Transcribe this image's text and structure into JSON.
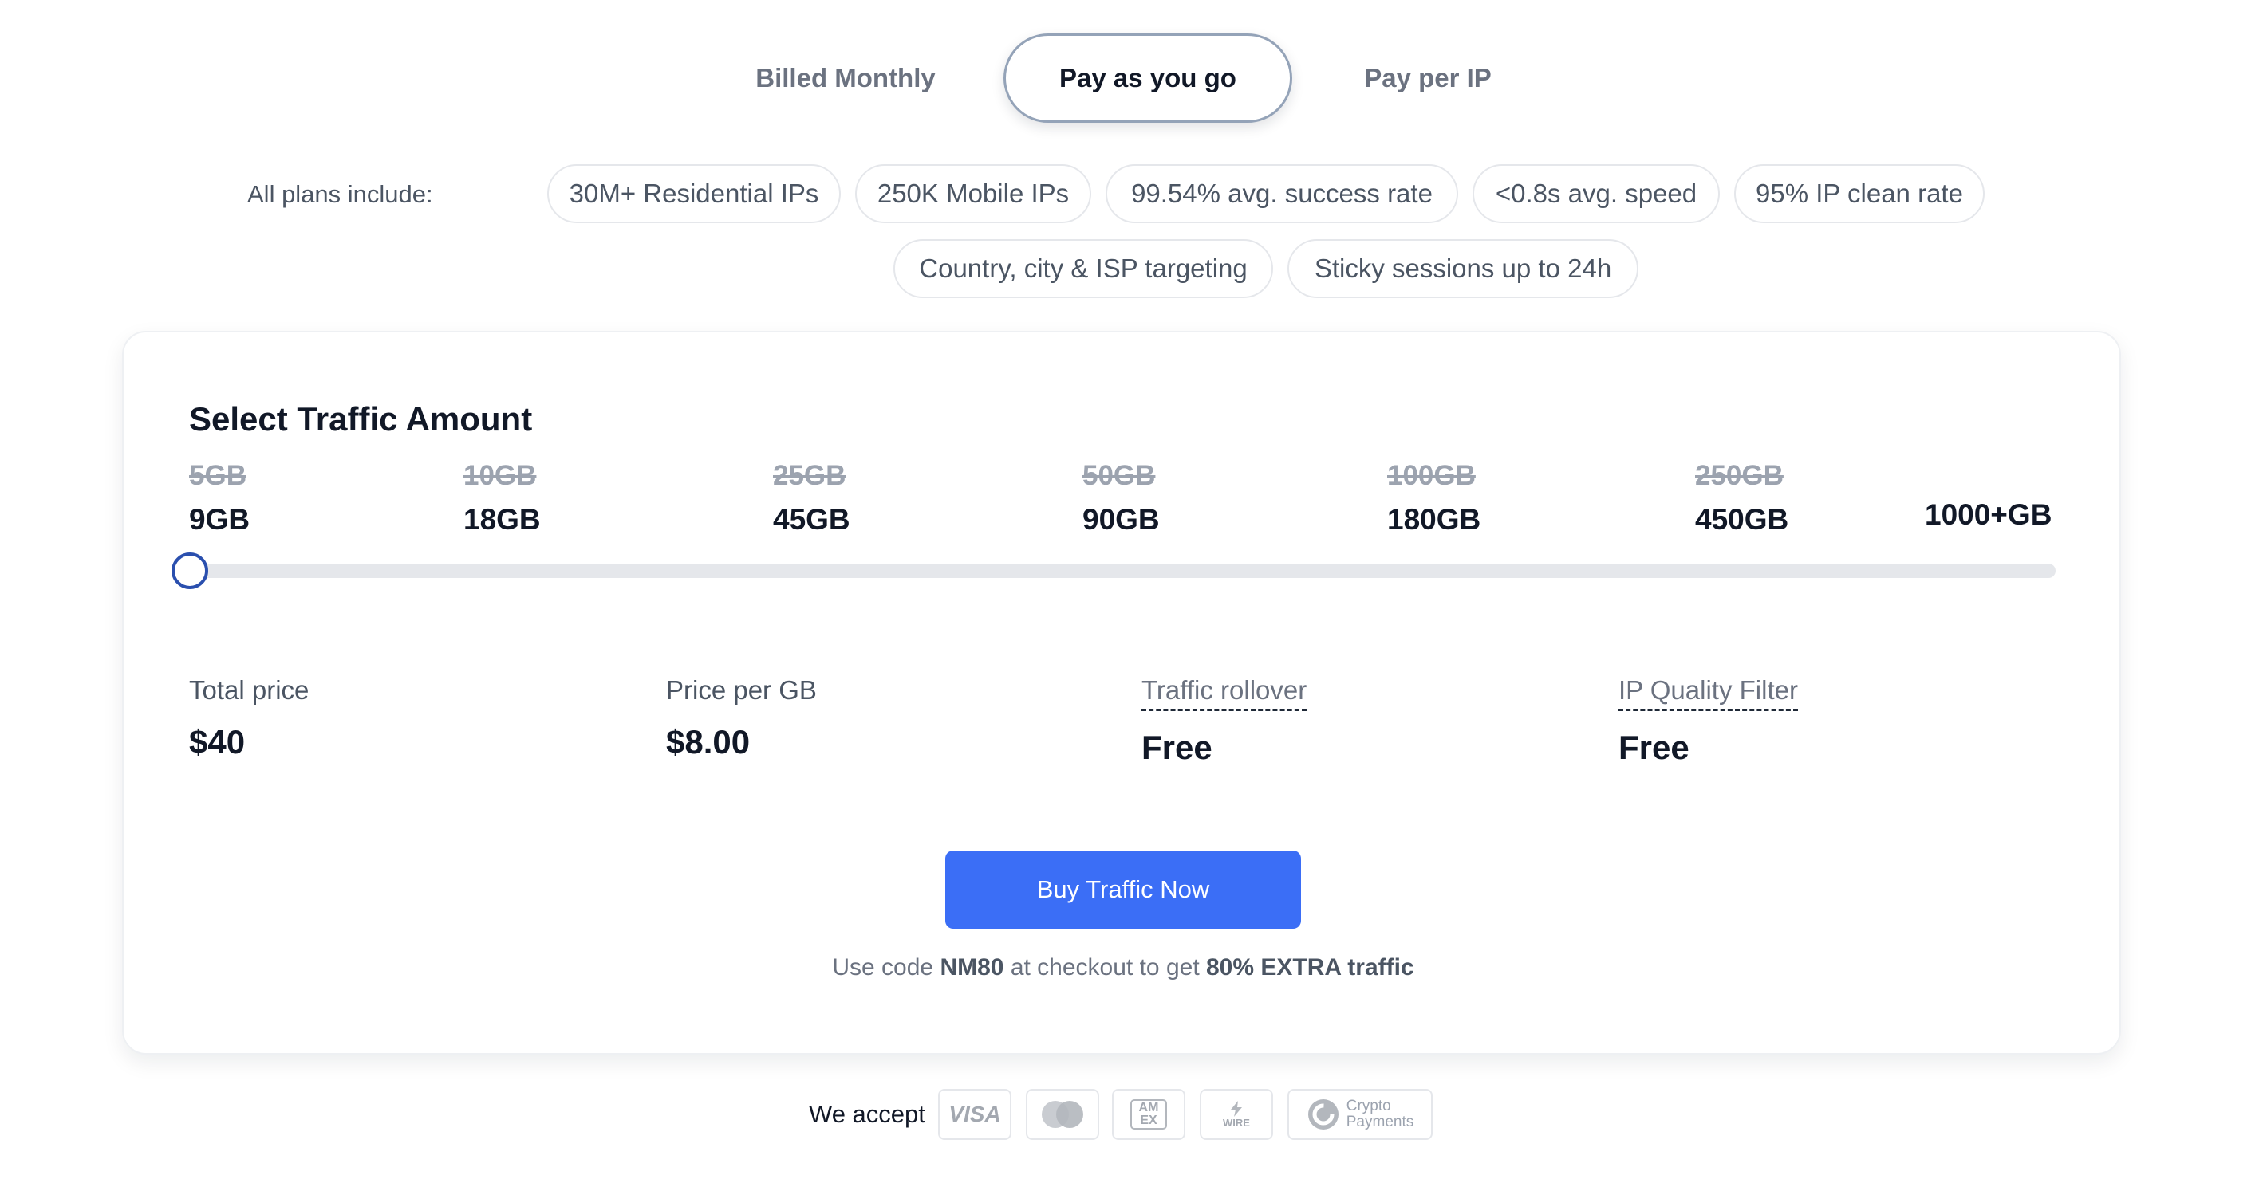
{
  "tabs": [
    {
      "label": "Billed Monthly",
      "active": false
    },
    {
      "label": "Pay as you go",
      "active": true
    },
    {
      "label": "Pay per IP",
      "active": false
    }
  ],
  "features": {
    "label": "All plans include:",
    "items": [
      "30M+ Residential IPs",
      "250K Mobile IPs",
      "99.54% avg. success rate",
      "<0.8s avg. speed",
      "95% IP clean rate",
      "Country, city & ISP targeting",
      "Sticky sessions up to 24h"
    ]
  },
  "traffic": {
    "title": "Select Traffic Amount",
    "tiers": [
      {
        "old": "5GB",
        "new": "9GB"
      },
      {
        "old": "10GB",
        "new": "18GB"
      },
      {
        "old": "25GB",
        "new": "45GB"
      },
      {
        "old": "50GB",
        "new": "90GB"
      },
      {
        "old": "100GB",
        "new": "180GB"
      },
      {
        "old": "250GB",
        "new": "450GB"
      }
    ],
    "last_tier": "1000+GB",
    "selected_index": 0
  },
  "stats": [
    {
      "label": "Total price",
      "value": "$40"
    },
    {
      "label": "Price per GB",
      "value": "$8.00"
    },
    {
      "label": "Traffic rollover",
      "value": "Free"
    },
    {
      "label": "IP Quality Filter",
      "value": "Free"
    }
  ],
  "cta": {
    "button": "Buy Traffic Now",
    "promo_prefix": "Use code",
    "promo_code": "NM80",
    "promo_middle": "at checkout to get",
    "promo_bonus": "80% EXTRA traffic"
  },
  "payments": {
    "label": "We accept",
    "visa": "VISA",
    "amex": "AM EX",
    "wire": "WIRE",
    "crypto_line1": "Crypto",
    "crypto_line2": "Payments"
  },
  "colors": {
    "accent": "#3b6ef6",
    "slider_thumb": "#2a4fae"
  }
}
